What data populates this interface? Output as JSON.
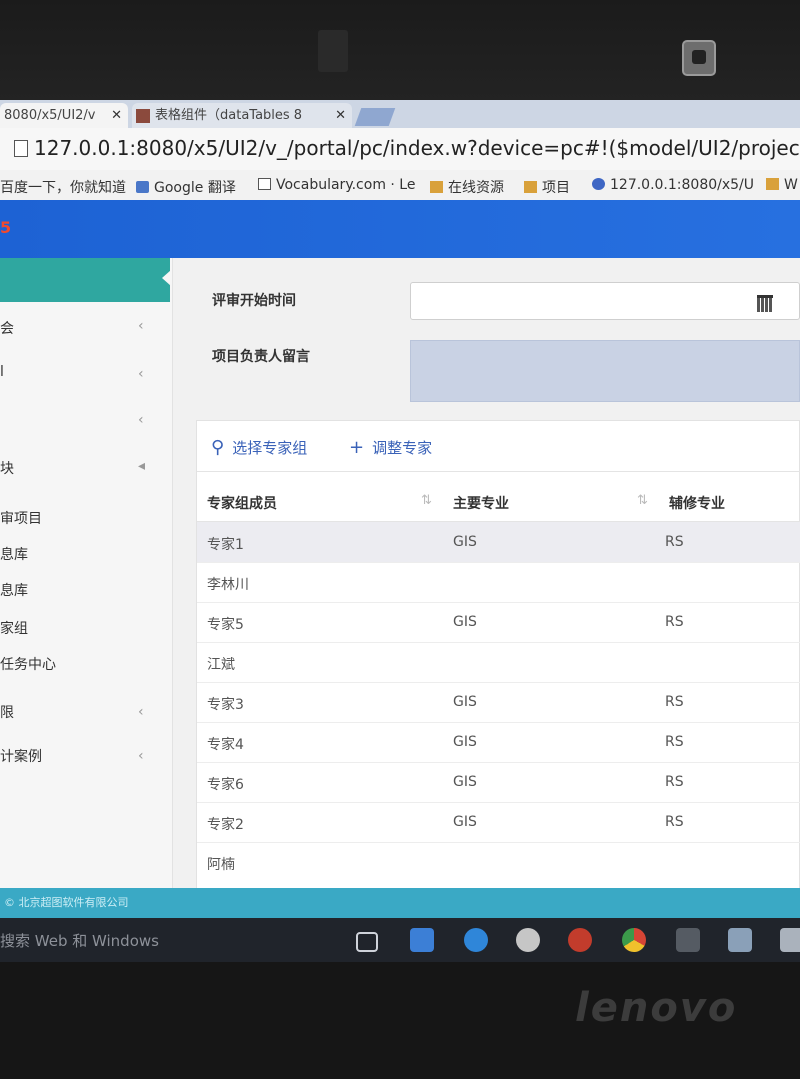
{
  "browser": {
    "tabs": [
      {
        "label": "8080/x5/UI2/v"
      },
      {
        "label": "表格组件（dataTables 8"
      }
    ],
    "url": "127.0.0.1:8080/x5/UI2/v_/portal/pc/index.w?device=pc#!($model/UI2/projectgrade/pc",
    "bookmarks": [
      {
        "label": "百度一下，你就知道",
        "icon": "none"
      },
      {
        "label": "Google 翻译",
        "icon": "google-translate-icon"
      },
      {
        "label": "Vocabulary.com · Le",
        "icon": "page-icon"
      },
      {
        "label": "在线资源",
        "icon": "folder-icon"
      },
      {
        "label": "项目",
        "icon": "folder-icon"
      },
      {
        "label": "127.0.0.1:8080/x5/U",
        "icon": "globe-icon"
      },
      {
        "label": "W",
        "icon": "folder-icon"
      }
    ]
  },
  "app": {
    "header_mark": "5",
    "sidebar": {
      "items": [
        {
          "label": "会",
          "chevron": "‹"
        },
        {
          "label": "l",
          "chevron": "‹"
        },
        {
          "label": "",
          "chevron": "‹"
        },
        {
          "label": "块",
          "chevron": "◂"
        },
        {
          "label": "审项目",
          "chevron": ""
        },
        {
          "label": "息库",
          "chevron": ""
        },
        {
          "label": "息库",
          "chevron": ""
        },
        {
          "label": "家组",
          "chevron": ""
        },
        {
          "label": "任务中心",
          "chevron": ""
        },
        {
          "label": "限",
          "chevron": "‹"
        },
        {
          "label": "计案例",
          "chevron": "‹"
        }
      ]
    },
    "form": {
      "start_time_label": "评审开始时间",
      "leader_message_label": "项目负责人留言"
    },
    "grid": {
      "toolbar": {
        "select_group": "选择专家组",
        "adjust_expert": "调整专家"
      },
      "columns": [
        "专家组成员",
        "主要专业",
        "辅修专业"
      ],
      "rows": [
        [
          "专家1",
          "GIS",
          "RS"
        ],
        [
          "李林川",
          "",
          ""
        ],
        [
          "专家5",
          "GIS",
          "RS"
        ],
        [
          "江斌",
          "",
          ""
        ],
        [
          "专家3",
          "GIS",
          "RS"
        ],
        [
          "专家4",
          "GIS",
          "RS"
        ],
        [
          "专家6",
          "GIS",
          "RS"
        ],
        [
          "专家2",
          "GIS",
          "RS"
        ],
        [
          "阿楠",
          "",
          ""
        ]
      ],
      "selected_row": 0
    },
    "footer": "© 北京超图软件有限公司"
  },
  "taskbar": {
    "search_placeholder": "搜索 Web 和 Windows"
  },
  "device": {
    "brand": "lenovo"
  },
  "colors": {
    "header_blue": "#1d62d4",
    "sidebar_teal": "#2fa7a0",
    "footer_teal": "#3aa9c5",
    "link_blue": "#3a62b8"
  }
}
